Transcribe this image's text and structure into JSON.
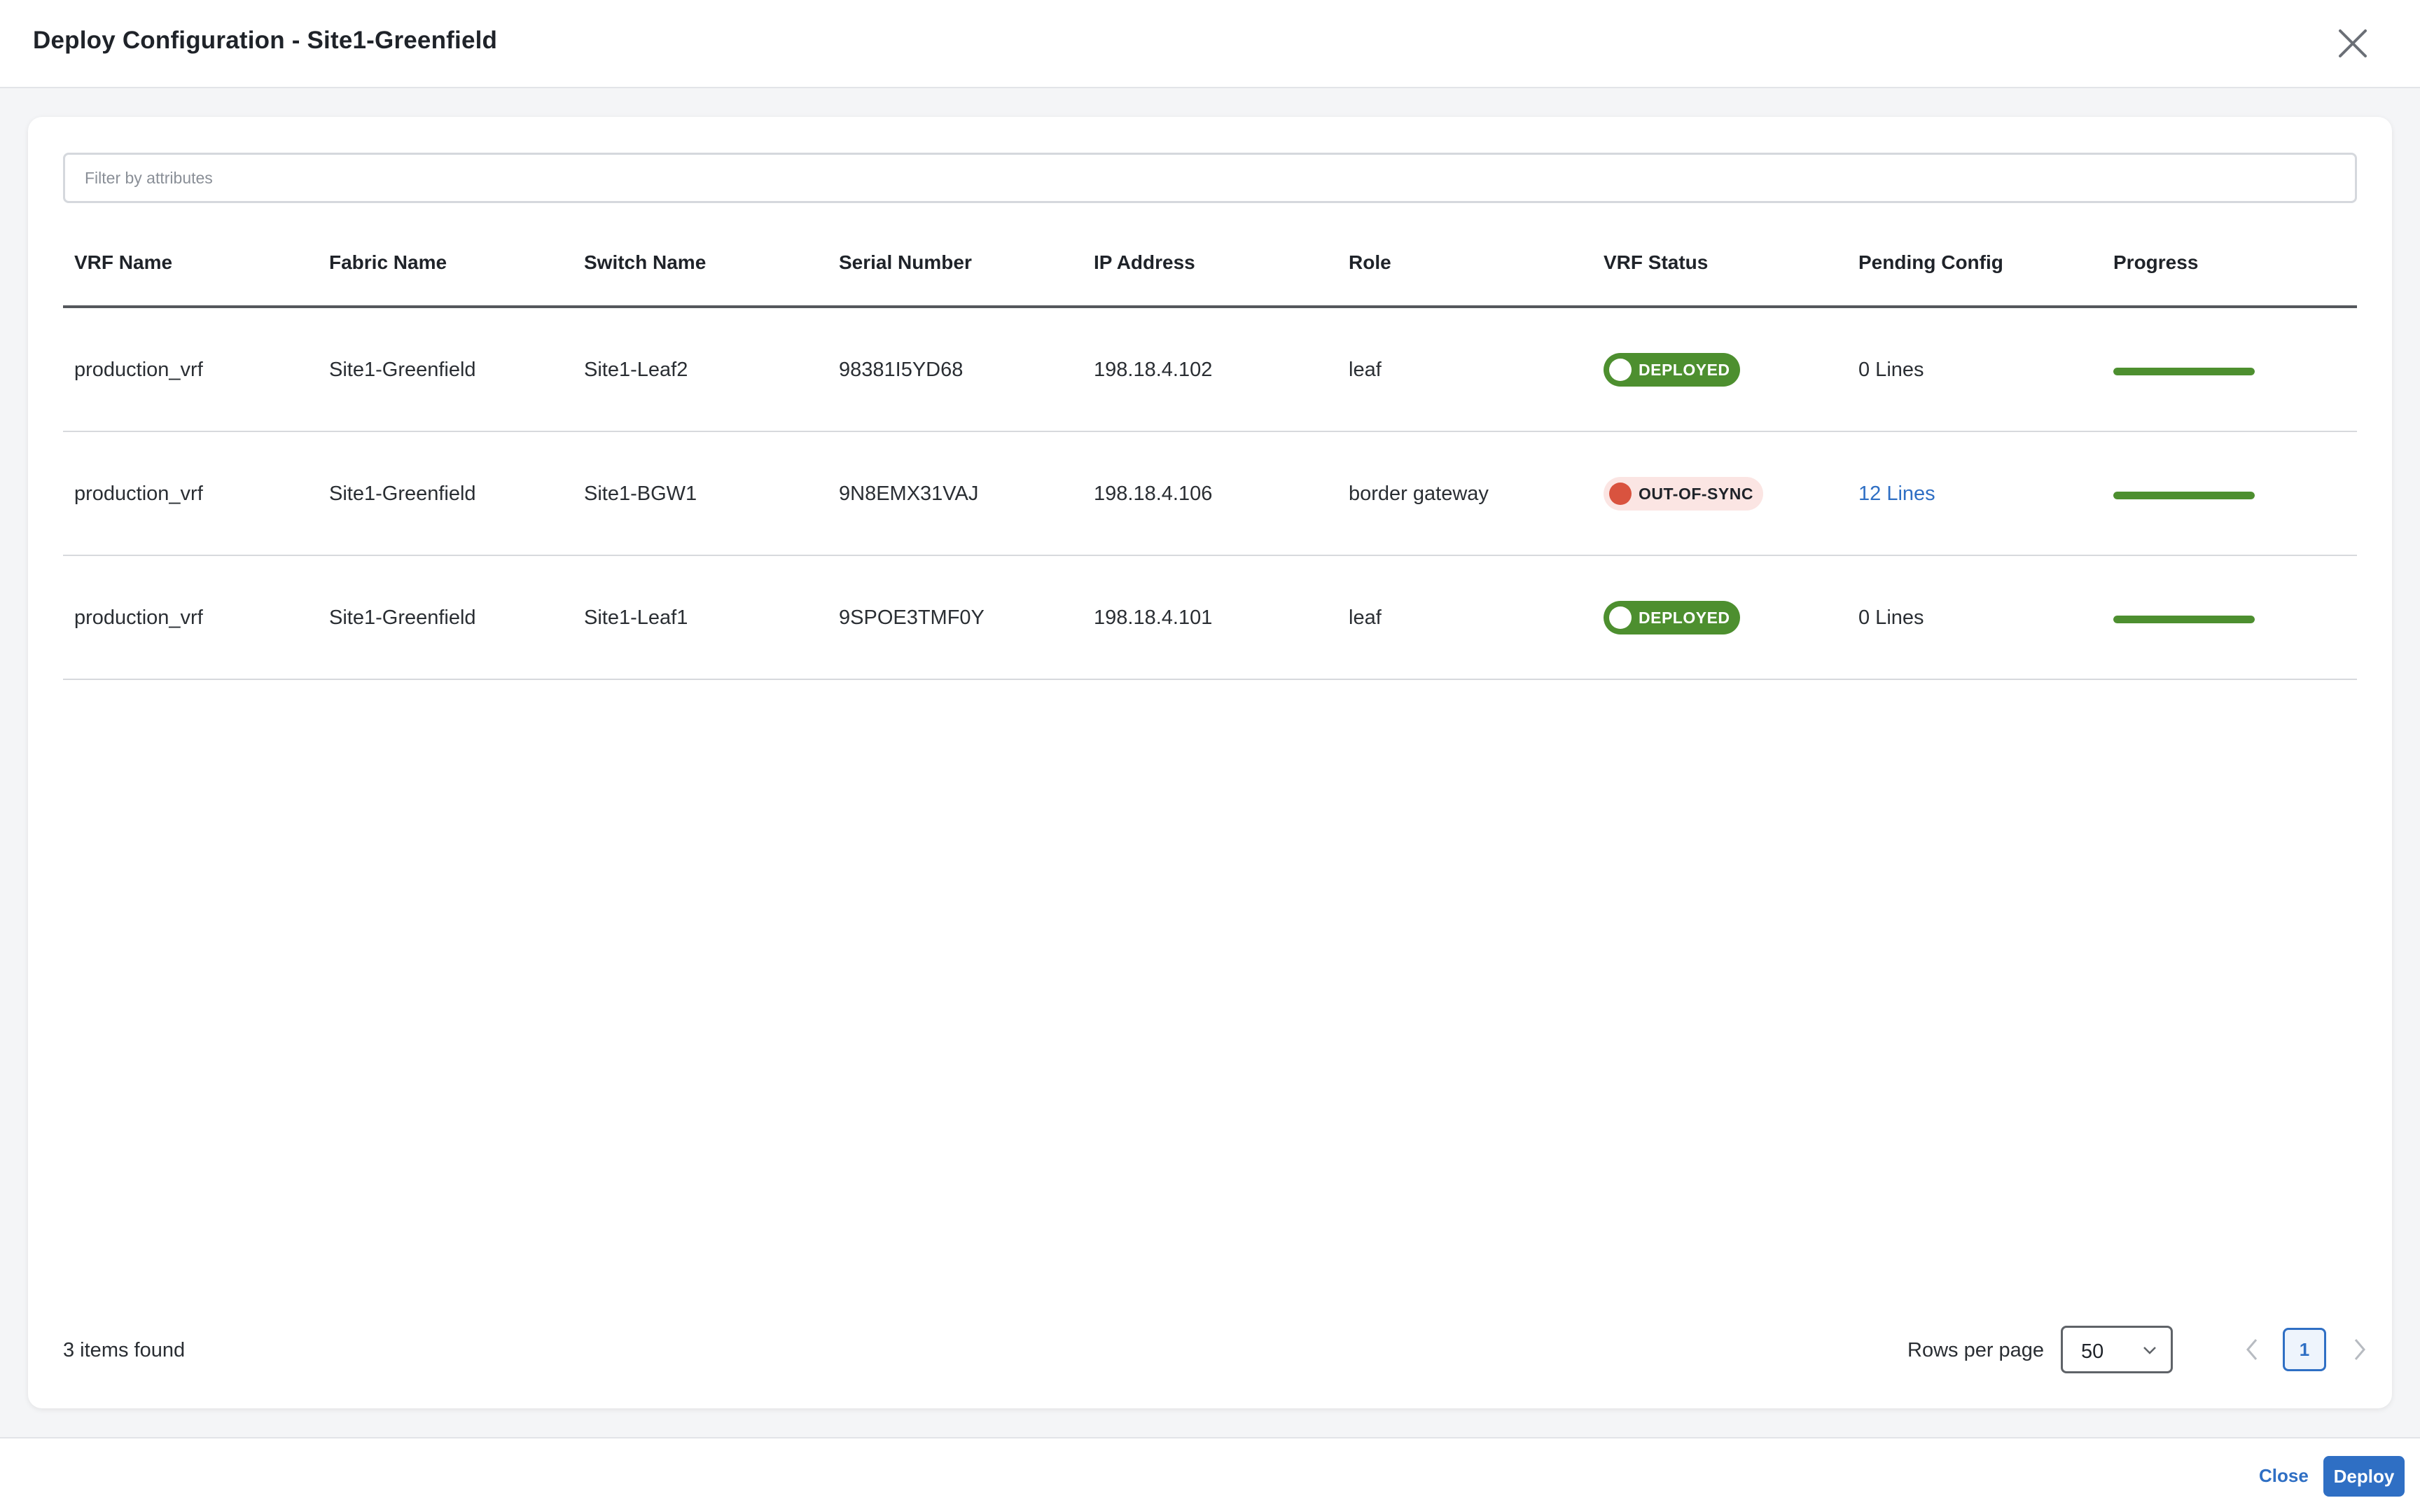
{
  "header": {
    "title": "Deploy Configuration - Site1-Greenfield",
    "close_icon": "close-icon"
  },
  "filter": {
    "placeholder": "Filter by attributes",
    "value": ""
  },
  "table": {
    "columns": [
      "VRF Name",
      "Fabric Name",
      "Switch Name",
      "Serial Number",
      "IP Address",
      "Role",
      "VRF Status",
      "Pending Config",
      "Progress"
    ],
    "rows": [
      {
        "vrf_name": "production_vrf",
        "fabric_name": "Site1-Greenfield",
        "switch_name": "Site1-Leaf2",
        "serial_number": "98381I5YD68",
        "ip_address": "198.18.4.102",
        "role": "leaf",
        "vrf_status": "DEPLOYED",
        "pending_config": "0 Lines",
        "progress": 1.0
      },
      {
        "vrf_name": "production_vrf",
        "fabric_name": "Site1-Greenfield",
        "switch_name": "Site1-BGW1",
        "serial_number": "9N8EMX31VAJ",
        "ip_address": "198.18.4.106",
        "role": "border gateway",
        "vrf_status": "OUT-OF-SYNC",
        "pending_config": "12 Lines",
        "progress": 1.0
      },
      {
        "vrf_name": "production_vrf",
        "fabric_name": "Site1-Greenfield",
        "switch_name": "Site1-Leaf1",
        "serial_number": "9SPOE3TMF0Y",
        "ip_address": "198.18.4.101",
        "role": "leaf",
        "vrf_status": "DEPLOYED",
        "pending_config": "0 Lines",
        "progress": 1.0
      }
    ]
  },
  "footer": {
    "items_found": "3 items found",
    "rows_per_page_label": "Rows per page",
    "rows_per_page_value": "50",
    "current_page": "1"
  },
  "actions": {
    "close_label": "Close",
    "deploy_label": "Deploy"
  },
  "colors": {
    "accent": "#2f6fc4",
    "deployed": "#4d8f2f",
    "out_of_sync_dot": "#d9533f",
    "out_of_sync_bg": "#fbe5e3"
  }
}
